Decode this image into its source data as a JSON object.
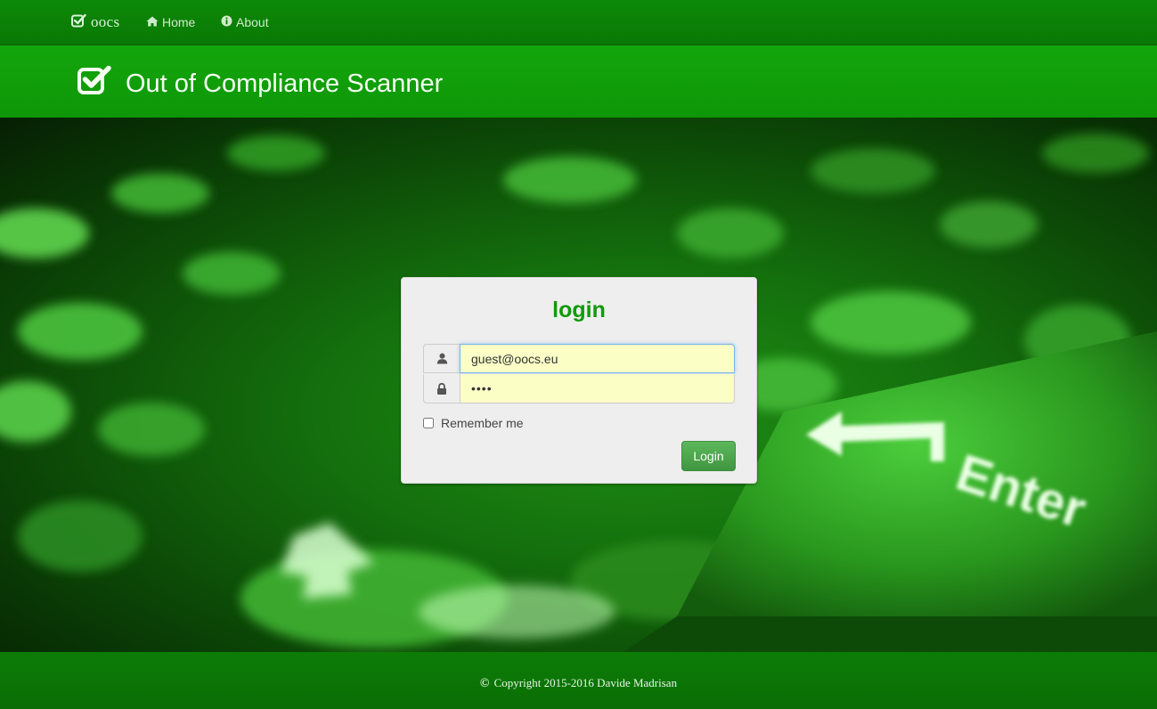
{
  "nav": {
    "brand": "oocs",
    "home_label": "Home",
    "about_label": "About"
  },
  "banner": {
    "title": "Out of Compliance Scanner"
  },
  "login": {
    "title": "login",
    "username_value": "guest@oocs.eu",
    "password_value": "••••",
    "remember_label": "Remember me",
    "remember_checked": false,
    "button_label": "Login"
  },
  "hero": {
    "key_label": "Enter"
  },
  "footer": {
    "copyright_symbol": "©",
    "text": "Copyright 2015-2016 Davide Madrisan"
  },
  "colors": {
    "navbar": "#0a7806",
    "banner": "#13a60c",
    "accent": "#109a0a",
    "input_bg": "#fbffc6",
    "button": "#5cb85c"
  },
  "icons": {
    "brand": "check-square-icon",
    "home": "home-icon",
    "about": "info-circle-icon",
    "user": "user-icon",
    "lock": "lock-icon"
  }
}
